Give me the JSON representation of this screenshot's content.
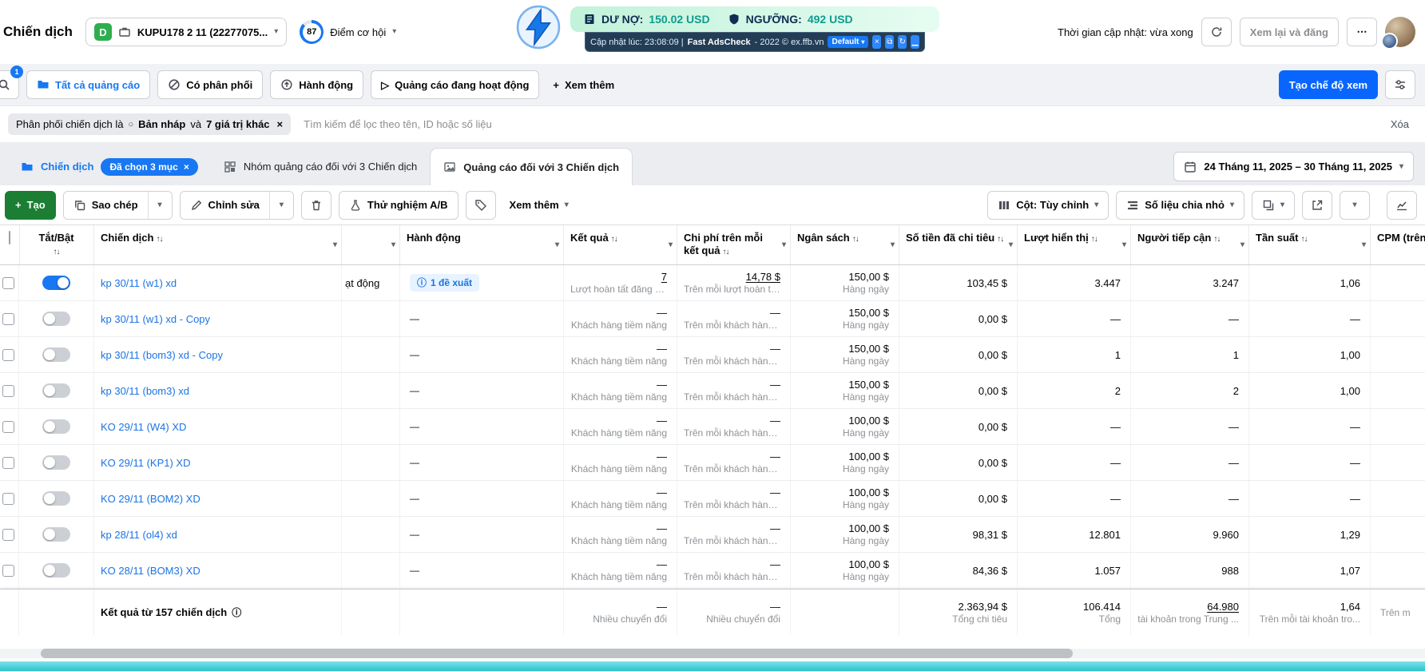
{
  "icons": {
    "chevron": "▾",
    "sort": "↑↓",
    "plus": "+",
    "close": "×",
    "info": "ⓘ",
    "ellipsis": "⋯",
    "minimize": "▁",
    "popout": "⧉",
    "refresh": "↻",
    "draft": "○",
    "play": "▷"
  },
  "header": {
    "title": "Chiến dịch",
    "account_badge": "D",
    "account_name": "KUPU178 2 11 (22277075...",
    "score": "87",
    "score_label": "Điểm cơ hội",
    "update_time": "Thời gian cập nhật: vừa xong",
    "review_label": "Xem lại và đăng"
  },
  "overlay": {
    "debt_label": "DƯ NỢ:",
    "debt_value": "150.02 USD",
    "threshold_label": "NGƯỠNG:",
    "threshold_value": "492 USD",
    "status_prefix": "Cập nhật lúc: 23:08:09 |",
    "brand": "Fast AdsCheck",
    "status_suffix": "- 2022 © ex.ffb.vn",
    "profile": "Default"
  },
  "filterbar": {
    "search_badge": "1",
    "pills": [
      "Tất cả quảng cáo",
      "Có phân phối",
      "Hành động",
      "Quảng cáo đang hoạt động"
    ],
    "more_label": "Xem thêm",
    "create_view_label": "Tạo chế độ xem"
  },
  "filters": {
    "chip_prefix": "Phân phối chiến dịch là",
    "chip_value": "Bản nháp",
    "chip_joiner": "và",
    "chip_extra": "7 giá trị khác",
    "placeholder": "Tìm kiếm để lọc theo tên, ID hoặc số liệu",
    "clear_label": "Xóa"
  },
  "tabs": {
    "campaign_label": "Chiến dịch",
    "campaign_badge": "Đã chọn 3 mục",
    "adset_label": "Nhóm quảng cáo đối với 3 Chiến dịch",
    "ad_label": "Quảng cáo đối với 3 Chiến dịch",
    "date_range": "24 Tháng 11, 2025 – 30 Tháng 11, 2025"
  },
  "toolbar": {
    "create_label": "Tạo",
    "duplicate_label": "Sao chép",
    "edit_label": "Chỉnh sửa",
    "abtest_label": "Thử nghiệm A/B",
    "more_label": "Xem thêm",
    "columns_label": "Cột: Tùy chỉnh",
    "breakdown_label": "Số liệu chia nhỏ"
  },
  "table": {
    "columns": {
      "toggle": "Tắt/Bật",
      "campaign": "Chiến dịch",
      "action": "Hành động",
      "results": "Kết quả",
      "cost": "Chi phí trên mỗi kết quả",
      "budget": "Ngân sách",
      "spent": "Số tiền đã chi tiêu",
      "impressions": "Lượt hiển thị",
      "reach": "Người tiếp cận",
      "frequency": "Tần suất",
      "cpm": "CPM (trên m"
    },
    "rows": [
      {
        "name": "kp 30/11 (w1) xd",
        "on": true,
        "underline": true,
        "delivery": "ạt động",
        "action": "1 đề xuất",
        "action_pill": true,
        "result": "7",
        "result_sub": "Lượt hoàn tất đăng k...",
        "cost": "14,78 $",
        "cost_sub": "Trên mỗi lượt hoàn tấ...",
        "budget": "150,00 $",
        "budget_sub": "Hàng ngày",
        "spent": "103,45 $",
        "impressions": "3.447",
        "reach": "3.247",
        "frequency": "1,06"
      },
      {
        "name": "kp 30/11 (w1) xd - Copy",
        "on": false,
        "delivery": "",
        "action": "—",
        "result": "—",
        "result_sub": "Khách hàng tiềm năng",
        "cost": "—",
        "cost_sub": "Trên mỗi khách hàng t...",
        "budget": "150,00 $",
        "budget_sub": "Hàng ngày",
        "spent": "0,00 $",
        "impressions": "—",
        "reach": "—",
        "frequency": "—"
      },
      {
        "name": "kp 30/11 (bom3) xd - Copy",
        "on": false,
        "delivery": "",
        "action": "—",
        "result": "—",
        "result_sub": "Khách hàng tiềm năng",
        "cost": "—",
        "cost_sub": "Trên mỗi khách hàng t...",
        "budget": "150,00 $",
        "budget_sub": "Hàng ngày",
        "spent": "0,00 $",
        "impressions": "1",
        "reach": "1",
        "frequency": "1,00"
      },
      {
        "name": "kp 30/11 (bom3) xd",
        "on": false,
        "delivery": "",
        "action": "—",
        "result": "—",
        "result_sub": "Khách hàng tiềm năng",
        "cost": "—",
        "cost_sub": "Trên mỗi khách hàng t...",
        "budget": "150,00 $",
        "budget_sub": "Hàng ngày",
        "spent": "0,00 $",
        "impressions": "2",
        "reach": "2",
        "frequency": "1,00"
      },
      {
        "name": "KO 29/11 (W4) XD",
        "on": false,
        "delivery": "",
        "action": "—",
        "result": "—",
        "result_sub": "Khách hàng tiềm năng",
        "cost": "—",
        "cost_sub": "Trên mỗi khách hàng t...",
        "budget": "100,00 $",
        "budget_sub": "Hàng ngày",
        "spent": "0,00 $",
        "impressions": "—",
        "reach": "—",
        "frequency": "—"
      },
      {
        "name": "KO 29/11 (KP1) XD",
        "on": false,
        "delivery": "",
        "action": "—",
        "result": "—",
        "result_sub": "Khách hàng tiềm năng",
        "cost": "—",
        "cost_sub": "Trên mỗi khách hàng t...",
        "budget": "100,00 $",
        "budget_sub": "Hàng ngày",
        "spent": "0,00 $",
        "impressions": "—",
        "reach": "—",
        "frequency": "—"
      },
      {
        "name": "KO 29/11 (BOM2) XD",
        "on": false,
        "delivery": "",
        "action": "—",
        "result": "—",
        "result_sub": "Khách hàng tiềm năng",
        "cost": "—",
        "cost_sub": "Trên mỗi khách hàng t...",
        "budget": "100,00 $",
        "budget_sub": "Hàng ngày",
        "spent": "0,00 $",
        "impressions": "—",
        "reach": "—",
        "frequency": "—"
      },
      {
        "name": "kp 28/11 (ol4) xd",
        "on": false,
        "delivery": "",
        "action": "—",
        "result": "—",
        "result_sub": "Khách hàng tiềm năng",
        "cost": "—",
        "cost_sub": "Trên mỗi khách hàng t...",
        "budget": "100,00 $",
        "budget_sub": "Hàng ngày",
        "spent": "98,31 $",
        "impressions": "12.801",
        "reach": "9.960",
        "frequency": "1,29"
      },
      {
        "name": "KO 28/11 (BOM3) XD",
        "on": false,
        "delivery": "",
        "action": "—",
        "result": "—",
        "result_sub": "Khách hàng tiềm năng",
        "cost": "—",
        "cost_sub": "Trên mỗi khách hàng t...",
        "budget": "100,00 $",
        "budget_sub": "Hàng ngày",
        "spent": "84,36 $",
        "impressions": "1.057",
        "reach": "988",
        "frequency": "1,07"
      }
    ],
    "footer": {
      "label": "Kết quả từ 157 chiến dịch",
      "result": "—",
      "result_sub": "Nhiều chuyển đổi",
      "cost": "—",
      "cost_sub": "Nhiều chuyển đổi",
      "spent": "2.363,94 $",
      "spent_sub": "Tổng chi tiêu",
      "impressions": "106.414",
      "impressions_sub": "Tổng",
      "reach": "64.980",
      "reach_sub": "tài khoản trong Trung ...",
      "frequency": "1,64",
      "frequency_sub": "Trên mỗi tài khoản tro...",
      "cpm_sub": "Trên m"
    }
  }
}
